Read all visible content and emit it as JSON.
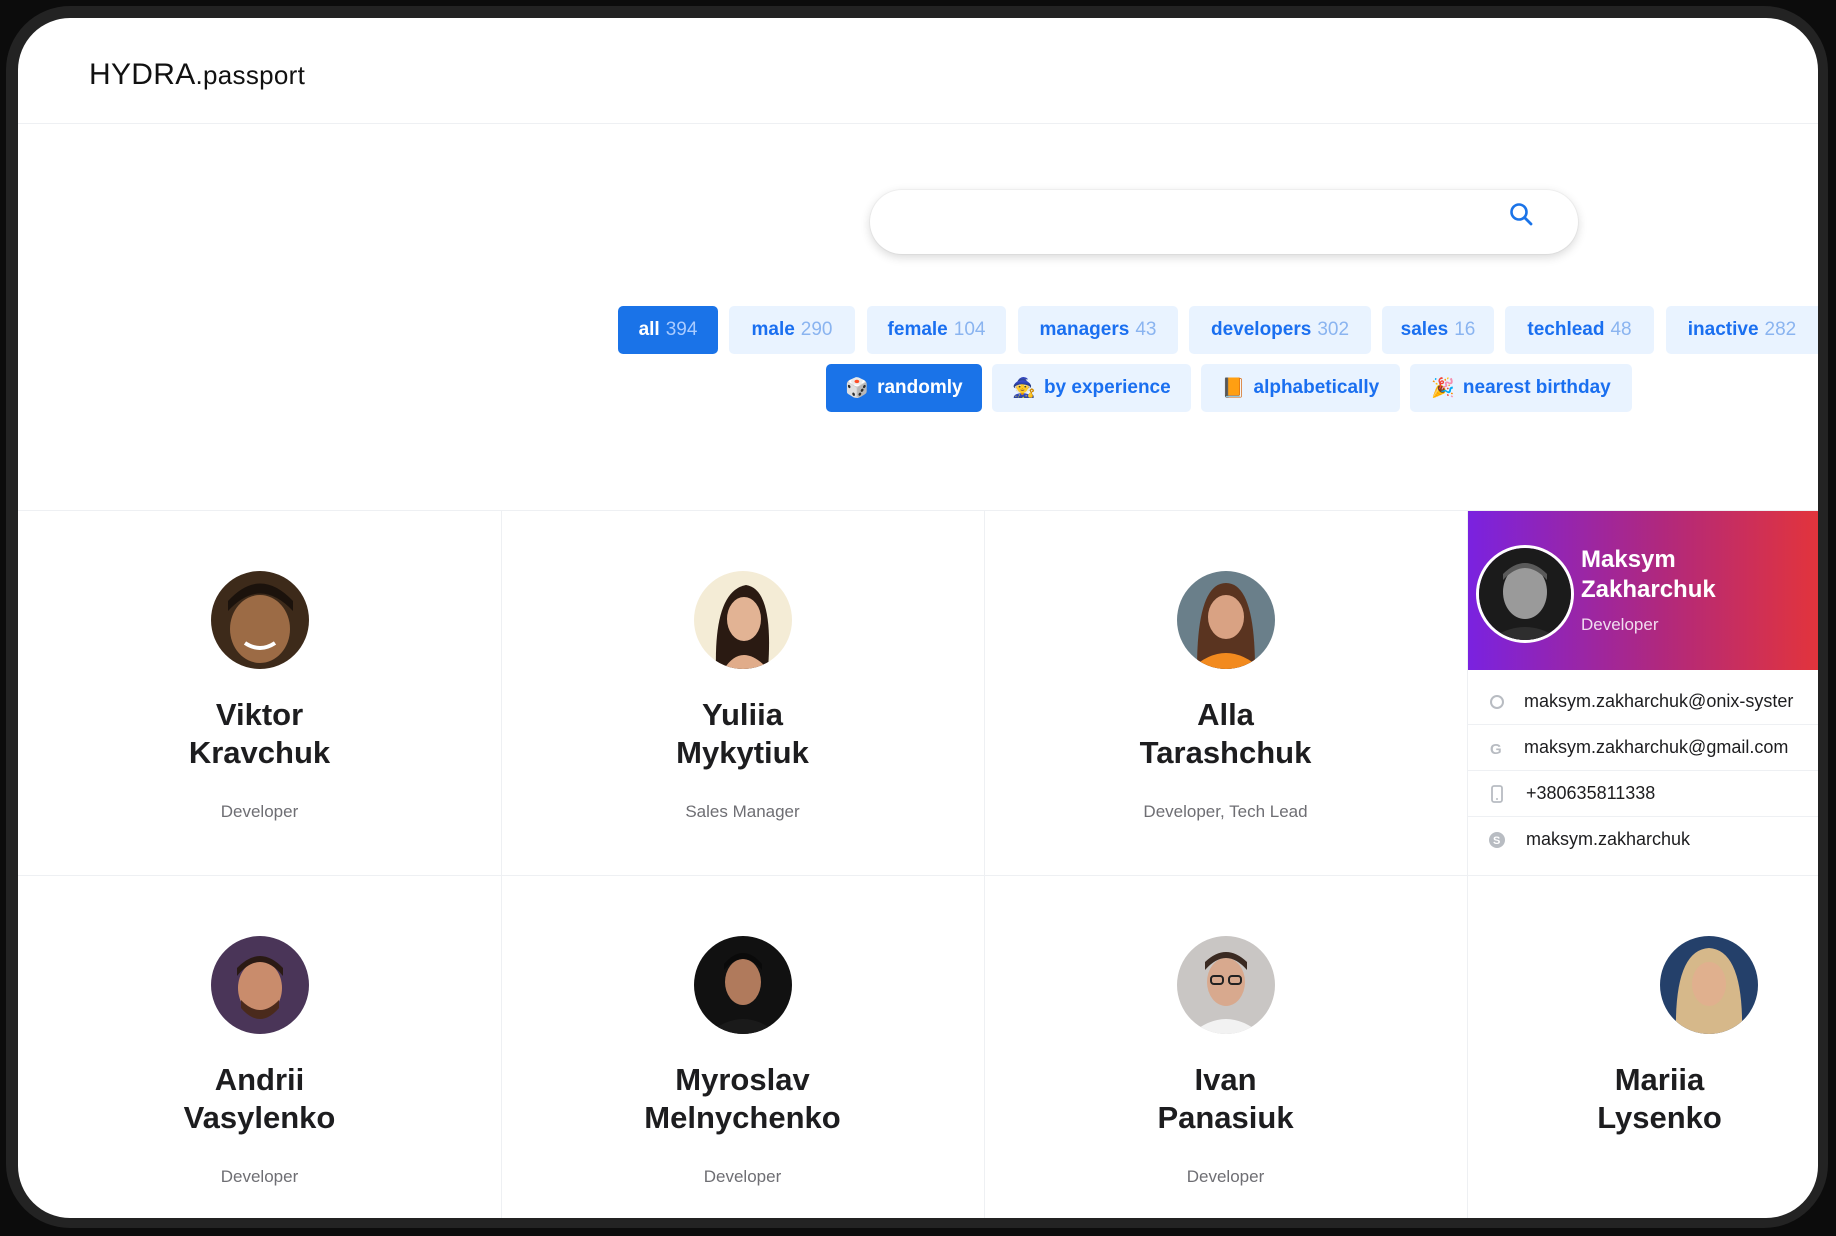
{
  "app": {
    "logo_bold": "HYDRA",
    "logo_light": ".passport"
  },
  "search": {
    "placeholder": "",
    "value": "",
    "icon": "search-icon"
  },
  "filters": [
    {
      "label": "all",
      "count": "394",
      "active": true
    },
    {
      "label": "male",
      "count": "290",
      "active": false
    },
    {
      "label": "female",
      "count": "104",
      "active": false
    },
    {
      "label": "managers",
      "count": "43",
      "active": false
    },
    {
      "label": "developers",
      "count": "302",
      "active": false
    },
    {
      "label": "sales",
      "count": "16",
      "active": false
    },
    {
      "label": "techlead",
      "count": "48",
      "active": false
    },
    {
      "label": "inactive",
      "count": "282",
      "active": false
    }
  ],
  "sort_options": [
    {
      "emoji": "🎲",
      "label": "randomly",
      "active": true
    },
    {
      "emoji": "🧙",
      "label": "by experience",
      "active": false
    },
    {
      "emoji": "📙",
      "label": "alphabetically",
      "active": false
    },
    {
      "emoji": "🎉",
      "label": "nearest birthday",
      "active": false
    }
  ],
  "people": [
    {
      "first": "Viktor",
      "last": "Kravchuk",
      "role": "Developer"
    },
    {
      "first": "Yuliia",
      "last": "Mykytiuk",
      "role": "Sales Manager"
    },
    {
      "first": "Alla",
      "last": "Tarashchuk",
      "role": "Developer, Tech Lead"
    },
    {
      "first": "Andrii",
      "last": "Vasylenko",
      "role": "Developer"
    },
    {
      "first": "Myroslav",
      "last": "Melnychenko",
      "role": "Developer"
    },
    {
      "first": "Ivan",
      "last": "Panasiuk",
      "role": "Developer"
    },
    {
      "first": "Mariia",
      "last": "Lysenko",
      "role": ""
    }
  ],
  "selected_person": {
    "first": "Maksym",
    "last": "Zakharchuk",
    "role": "Developer",
    "contacts": [
      {
        "icon": "email-icon",
        "value": "maksym.zakharchuk@onix-syster"
      },
      {
        "icon": "google-icon",
        "value": "maksym.zakharchuk@gmail.com"
      },
      {
        "icon": "phone-icon",
        "value": "+380635811338"
      },
      {
        "icon": "skype-icon",
        "value": "maksym.zakharchuk"
      }
    ]
  },
  "colors": {
    "accent": "#1a73e8",
    "chip_bg": "#e9f3ff",
    "gradient_start": "#7a22e0",
    "gradient_end": "#e2343c"
  }
}
